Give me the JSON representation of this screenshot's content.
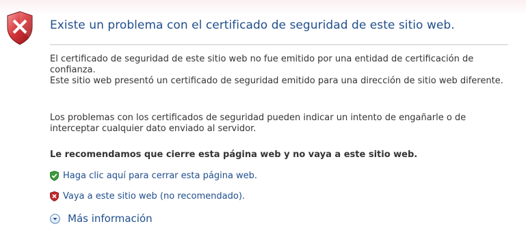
{
  "page": {
    "title": "Existe un problema con el certificado de seguridad de este sitio web.",
    "shield_icon": "error-shield-icon",
    "paragraph1_line1": "El certificado de seguridad de este sitio web no fue emitido por una entidad de certificación de confianza.",
    "paragraph1_line2": "Este sitio web presentó un certificado de seguridad emitido para una dirección de sitio web diferente.",
    "paragraph2": "Los problemas con los certificados de seguridad pueden indicar un intento de engañarle o de interceptar cualquier dato enviado al servidor.",
    "recommendation": "Le recomendamos que cierre esta página web y no vaya a este sitio web.",
    "action_close": {
      "label": "Haga clic aquí para cerrar esta página web.",
      "icon": "green-check-shield-icon"
    },
    "action_continue": {
      "label": "Vaya a este sitio web (no recomendado).",
      "icon": "red-x-shield-icon"
    },
    "more_info": {
      "label": "Más información",
      "icon": "chevron-down-circle-icon"
    }
  },
  "colors": {
    "title": "#1f4e8c",
    "link": "#1f4e8c",
    "text": "#333333",
    "error_red": "#c0282d",
    "safe_green": "#3a9a3a"
  }
}
